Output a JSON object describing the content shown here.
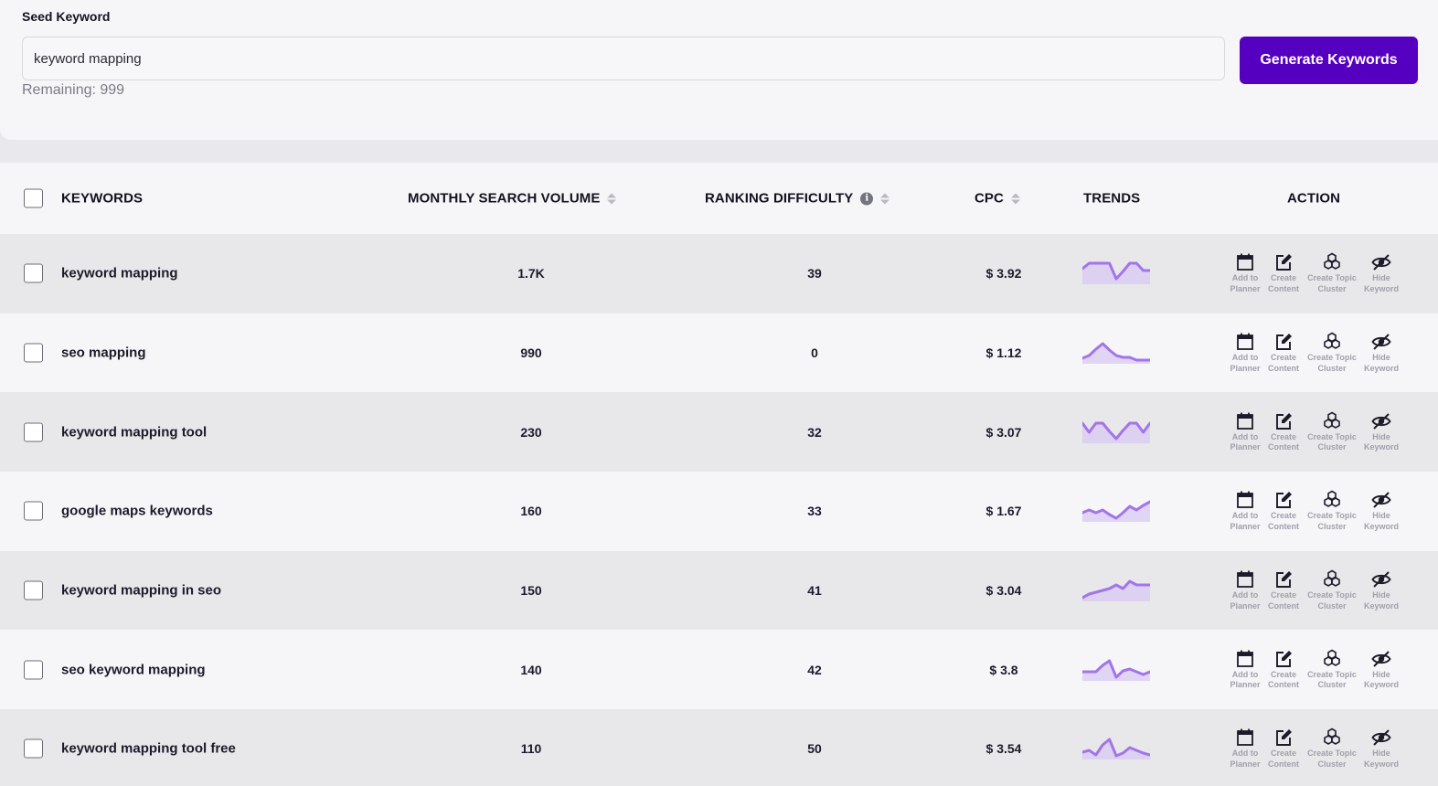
{
  "seed": {
    "label": "Seed Keyword",
    "input_value": "keyword mapping",
    "input_placeholder": "",
    "remaining": "Remaining: 999",
    "generate_button": "Generate Keywords",
    "accent_color": "#5500c0"
  },
  "table": {
    "headers": {
      "keywords": "KEYWORDS",
      "monthly_search_volume": "MONTHLY SEARCH VOLUME",
      "ranking_difficulty": "RANKING DIFFICULTY",
      "cpc": "CPC",
      "trends": "TRENDS",
      "action": "ACTION"
    },
    "info_icon": "i",
    "trend_color": "#a374ea",
    "actions": {
      "add_to_planner": "Add to\nPlanner",
      "create_content": "Create\nContent",
      "create_topic_cluster": "Create Topic\nCluster",
      "hide_keyword": "Hide\nKeyword"
    },
    "rows": [
      {
        "keyword": "keyword mapping",
        "volume": "1.7K",
        "difficulty": "39",
        "cpc": "$ 3.92",
        "trend": [
          0.7,
          1,
          1,
          1,
          1,
          0.15,
          0.55,
          1,
          1,
          0.6,
          0.6
        ]
      },
      {
        "keyword": "seo mapping",
        "volume": "990",
        "difficulty": "0",
        "cpc": "$ 1.12",
        "trend": [
          0.15,
          0.3,
          0.65,
          0.95,
          0.6,
          0.3,
          0.2,
          0.2,
          0.05,
          0.05,
          0.05
        ]
      },
      {
        "keyword": "keyword mapping tool",
        "volume": "230",
        "difficulty": "32",
        "cpc": "$ 3.07",
        "trend": [
          0.95,
          0.45,
          0.95,
          0.95,
          0.5,
          0.1,
          0.55,
          0.95,
          0.95,
          0.45,
          0.95
        ]
      },
      {
        "keyword": "google maps keywords",
        "volume": "160",
        "difficulty": "33",
        "cpc": "$ 1.67",
        "trend": [
          0.35,
          0.5,
          0.35,
          0.5,
          0.25,
          0.05,
          0.35,
          0.7,
          0.5,
          0.75,
          0.95
        ]
      },
      {
        "keyword": "keyword mapping in seo",
        "volume": "150",
        "difficulty": "41",
        "cpc": "$ 3.04",
        "trend": [
          0.05,
          0.25,
          0.35,
          0.45,
          0.55,
          0.75,
          0.55,
          0.95,
          0.75,
          0.75,
          0.75
        ]
      },
      {
        "keyword": "seo keyword mapping",
        "volume": "140",
        "difficulty": "42",
        "cpc": "$ 3.8",
        "trend": [
          0.35,
          0.35,
          0.35,
          0.7,
          0.95,
          0.05,
          0.4,
          0.5,
          0.35,
          0.2,
          0.35
        ]
      },
      {
        "keyword": "keyword mapping tool free",
        "volume": "110",
        "difficulty": "50",
        "cpc": "$ 3.54",
        "trend": [
          0.25,
          0.35,
          0.1,
          0.65,
          0.95,
          0.05,
          0.2,
          0.5,
          0.35,
          0.2,
          0.1
        ]
      }
    ]
  }
}
